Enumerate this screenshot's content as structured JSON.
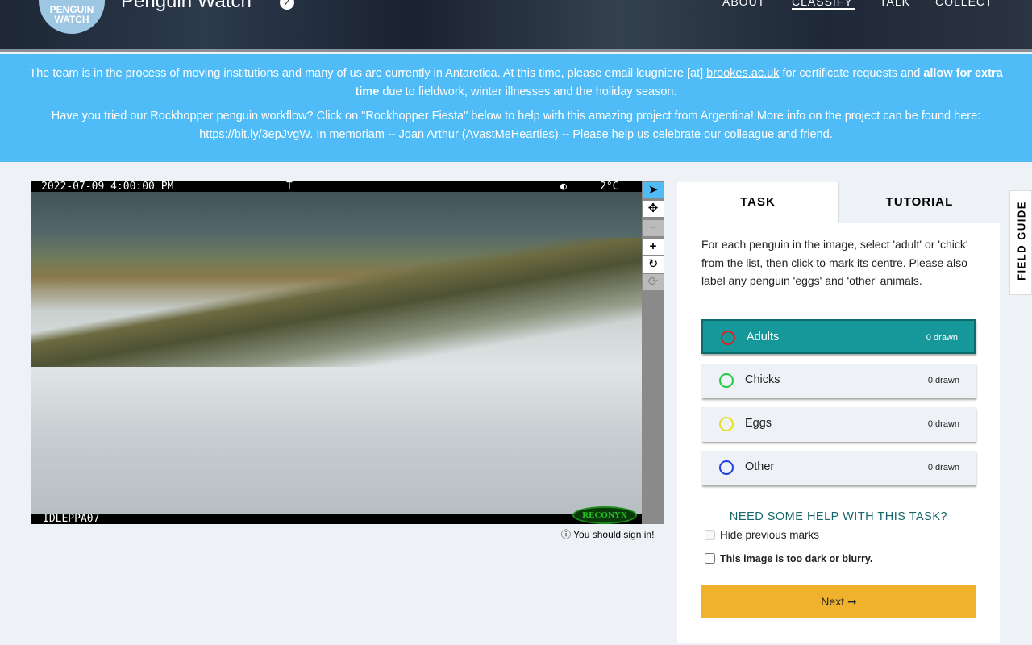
{
  "header": {
    "logo": "PENGUIN WATCH",
    "title": "Penguin Watch",
    "nav": [
      "ABOUT",
      "CLASSIFY",
      "TALK",
      "COLLECT"
    ]
  },
  "banner": {
    "p1_a": "The team is in the process of moving institutions and many of us are currently in Antarctica. At this time, please email lcugniere [at] ",
    "p1_link": "brookes.ac.uk",
    "p1_b": " for certificate requests and ",
    "p1_bold": "allow for extra time",
    "p1_c": " due to fieldwork, winter illnesses and the holiday season.",
    "p2_a": "Have you tried our Rockhopper penguin workflow? Click on \"Rockhopper Fiesta\" below to help with this amazing project from Argentina! More info on the project can be found here: ",
    "p2_link1": "https://bit.ly/3epJvgW",
    "p2_sep": ". ",
    "p2_link2": "In memoriam -- Joan Arthur (AvastMeHearties) -- Please help us celebrate our colleague and friend",
    "p2_end": "."
  },
  "image": {
    "timestamp": "2022-07-09 4:00:00 PM",
    "flag": "T",
    "temp": "2°C",
    "camera": "IDLEPPA07",
    "brand": "RECONYX"
  },
  "signin": "You should sign in!",
  "panel": {
    "tabs": [
      "TASK",
      "TUTORIAL"
    ],
    "instructions": "For each penguin in the image, select 'adult' or 'chick' from the list, then click to mark its centre. Please also label any penguin 'eggs' and 'other' animals.",
    "answers": [
      {
        "label": "Adults",
        "count": "0 drawn",
        "color": "#e02020"
      },
      {
        "label": "Chicks",
        "count": "0 drawn",
        "color": "#22cc44"
      },
      {
        "label": "Eggs",
        "count": "0 drawn",
        "color": "#e8e020"
      },
      {
        "label": "Other",
        "count": "0 drawn",
        "color": "#2040e0"
      }
    ],
    "help": "NEED SOME HELP WITH THIS TASK?",
    "hide_marks": "Hide previous marks",
    "too_dark": "This image is too dark or blurry.",
    "next": "Next ➞"
  },
  "field_guide": "FIELD GUIDE"
}
